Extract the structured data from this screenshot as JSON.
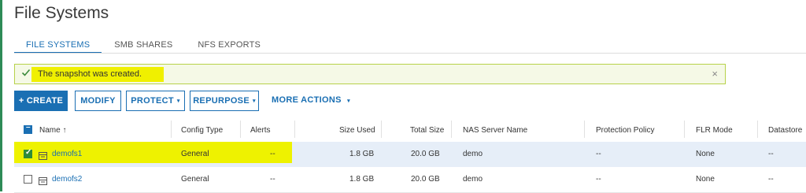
{
  "page": {
    "title": "File Systems"
  },
  "tabs": [
    {
      "label": "FILE SYSTEMS",
      "active": true
    },
    {
      "label": "SMB SHARES",
      "active": false
    },
    {
      "label": "NFS EXPORTS",
      "active": false
    }
  ],
  "alert": {
    "message": "The snapshot was created.",
    "close_glyph": "×"
  },
  "toolbar": {
    "create_label": "+ CREATE",
    "modify_label": "MODIFY",
    "protect_label": "PROTECT",
    "repurpose_label": "REPURPOSE",
    "more_actions_label": "MORE ACTIONS",
    "caret": "▾"
  },
  "table": {
    "headers": {
      "name": "Name ↑",
      "config_type": "Config Type",
      "alerts": "Alerts",
      "size_used": "Size Used",
      "total_size": "Total Size",
      "nas_server": "NAS Server Name",
      "protection_policy": "Protection Policy",
      "flr_mode": "FLR Mode",
      "datastore": "Datastore"
    },
    "rows": [
      {
        "name": "demofs1",
        "config_type": "General",
        "alerts": "--",
        "size_used": "1.8 GB",
        "total_size": "20.0 GB",
        "nas_server": "demo",
        "protection_policy": "--",
        "flr_mode": "None",
        "datastore": "--",
        "selected": true
      },
      {
        "name": "demofs2",
        "config_type": "General",
        "alerts": "--",
        "size_used": "1.8 GB",
        "total_size": "20.0 GB",
        "nas_server": "demo",
        "protection_policy": "--",
        "flr_mode": "None",
        "datastore": "--",
        "selected": false
      }
    ]
  },
  "colors": {
    "accent": "#1a6fb3",
    "highlight": "#eef200",
    "success": "#3b8a3b"
  }
}
